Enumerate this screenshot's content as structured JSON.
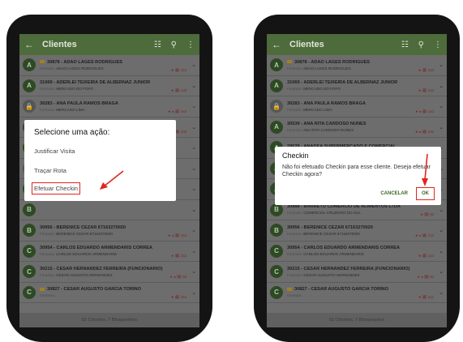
{
  "app": {
    "title": "Clientes",
    "back_icon": "arrow-left-icon",
    "filter_icon": "filter-icon",
    "search_icon": "search-icon",
    "menu_icon": "more-vertical-icon"
  },
  "colors": {
    "appbar": "#4e6b3b",
    "accent": "#3d6a23",
    "highlight": "#e0251f"
  },
  "left_list": [
    {
      "avatar": "A",
      "name": "30878 - ADAO LAGES RODRIGUES",
      "flag": true,
      "sub_label": "Fantasia:",
      "sub_value": "ADAO LAGES RODRIGUES",
      "meta": "★ 🗓 31d",
      "locked": false
    },
    {
      "avatar": "A",
      "name": "31069 - ADERLEI TEIXEIRA DE ALBERNAZ JUNIOR",
      "flag": false,
      "sub_label": "Fantasia:",
      "sub_value": "MERCADO DO FOFO",
      "meta": "★ 🗓 10d",
      "locked": false
    },
    {
      "avatar": "🔒",
      "name": "30283 - ANA PAULA RAMOS BRAGA",
      "flag": false,
      "sub_label": "Fantasia:",
      "sub_value": "MERCADO LIMA",
      "meta": "★ ● 🗓 14d",
      "locked": true
    },
    {
      "avatar": "A",
      "name": "30539 - ANA RITA CARDOSO NUNES",
      "flag": false,
      "sub_label": "Fantasia:",
      "sub_value": "ANA RITA CARDOSO NUNES",
      "meta": "★ ● 🗓 10d",
      "locked": false
    },
    {
      "avatar": "A",
      "name": "",
      "flag": false,
      "sub_label": "",
      "sub_value": "",
      "meta": "",
      "locked": false
    },
    {
      "avatar": "🔒",
      "name": "",
      "flag": false,
      "sub_label": "",
      "sub_value": "",
      "meta": "",
      "locked": true
    },
    {
      "avatar": "A",
      "name": "",
      "flag": false,
      "sub_label": "",
      "sub_value": "",
      "meta": "",
      "locked": false
    },
    {
      "avatar": "B",
      "name": "",
      "flag": false,
      "sub_label": "",
      "sub_value": "",
      "meta": "",
      "locked": false
    },
    {
      "avatar": "B",
      "name": "30956 - BERENICE CEZAR 67163270020",
      "flag": false,
      "sub_label": "Fantasia:",
      "sub_value": "BERENICE CEZAR 67163270020",
      "meta": "★ ● 🗓 21d",
      "locked": false
    },
    {
      "avatar": "C",
      "name": "30954 - CARLOS EDUARDO ARMENDARIS CORREA",
      "flag": false,
      "sub_label": "Fantasia:",
      "sub_value": "CARLOS EDUARDO ARMENDARIS",
      "meta": "★ 🗓 21d",
      "locked": false
    },
    {
      "avatar": "C",
      "name": "30215 - CESAR HERNANDEZ FERREIRA (FUNCIONARIO)",
      "flag": false,
      "sub_label": "Fantasia:",
      "sub_value": "CESAR AUGUSTO HERNANDEZ",
      "meta": "★ ● 🗓 9d",
      "locked": false
    },
    {
      "avatar": "C",
      "name": "30827 - CESAR AUGUSTO GARCIA TORINO",
      "flag": true,
      "sub_label": "Fantasia:",
      "sub_value": "",
      "meta": "★ 🗓 31d",
      "locked": false
    }
  ],
  "right_list": [
    {
      "avatar": "A",
      "name": "30878 - ADAO LAGES RODRIGUES",
      "flag": true,
      "sub_label": "Fantasia:",
      "sub_value": "ADAO LAGES RODRIGUES",
      "meta": "★ 🗓 31d",
      "locked": false
    },
    {
      "avatar": "A",
      "name": "31069 - ADERLEI TEIXEIRA DE ALBERNAZ JUNIOR",
      "flag": false,
      "sub_label": "Fantasia:",
      "sub_value": "MERCADO DO FOFO",
      "meta": "★ 🗓 10d",
      "locked": false
    },
    {
      "avatar": "🔒",
      "name": "30283 - ANA PAULA RAMOS BRAGA",
      "flag": false,
      "sub_label": "Fantasia:",
      "sub_value": "MERCADO LIMA",
      "meta": "★ ● 🗓 14d",
      "locked": true
    },
    {
      "avatar": "A",
      "name": "30539 - ANA RITA CARDOSO NUNES",
      "flag": false,
      "sub_label": "Fantasia:",
      "sub_value": "ANA RITA CARDOSO NUNES",
      "meta": "★ ● 🗓 10d",
      "locked": false
    },
    {
      "avatar": "A",
      "name": "29578 - ANADEA SUPERMERCADO E COMERCIAL",
      "flag": false,
      "sub_label": "",
      "sub_value": "",
      "meta": "",
      "locked": false
    },
    {
      "avatar": "A",
      "name": "",
      "flag": false,
      "sub_label": "",
      "sub_value": "",
      "meta": "",
      "locked": false
    },
    {
      "avatar": "A",
      "name": "",
      "flag": false,
      "sub_label": "",
      "sub_value": "",
      "meta": "",
      "locked": false
    },
    {
      "avatar": "B",
      "name": "30888 - BARRETO COMERCIO DE ALIMENTOS LTDA",
      "flag": false,
      "sub_label": "Fantasia:",
      "sub_value": "COMERCIAL CRUZEIRO DO SUL",
      "meta": "★ 🗓 9d",
      "locked": false
    },
    {
      "avatar": "B",
      "name": "30956 - BERENICE CEZAR 67163270020",
      "flag": false,
      "sub_label": "Fantasia:",
      "sub_value": "BERENICE CEZAR 67163270020",
      "meta": "★ ● 🗓 21d",
      "locked": false
    },
    {
      "avatar": "C",
      "name": "30954 - CARLOS EDUARDO ARMENDARIS CORREA",
      "flag": false,
      "sub_label": "Fantasia:",
      "sub_value": "CARLOS EDUARDO ARMENDARIS",
      "meta": "★ 🗓 21d",
      "locked": false
    },
    {
      "avatar": "C",
      "name": "30215 - CESAR HERNANDEZ FERREIRA (FUNCIONARIO)",
      "flag": false,
      "sub_label": "Fantasia:",
      "sub_value": "CESAR AUGUSTO HERNANDEZ",
      "meta": "★ ● 🗓 9d",
      "locked": false
    },
    {
      "avatar": "C",
      "name": "30827 - CESAR AUGUSTO GARCIA TORINO",
      "flag": true,
      "sub_label": "Fantasia:",
      "sub_value": "",
      "meta": "★ 🗓 31d",
      "locked": false
    }
  ],
  "footer": "52 Clientes, 7 Bloqueados",
  "action_dialog": {
    "title": "Selecione uma ação:",
    "items": [
      "Justificar Visita",
      "Traçar Rota",
      "Efetuar Checkin"
    ]
  },
  "confirm_dialog": {
    "title": "Checkin",
    "message": "Não foi efetuado Checkin para esse cliente. Deseja efetuar Checkin agora?",
    "cancel": "CANCELAR",
    "ok": "OK"
  }
}
